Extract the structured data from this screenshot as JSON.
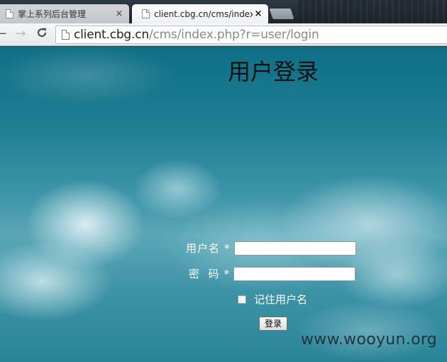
{
  "browser": {
    "tabs": [
      {
        "title": "掌上系列后台管理",
        "active": false
      },
      {
        "title": "client.cbg.cn/cms/index.",
        "active": true
      }
    ],
    "url_host": "client.cbg.cn",
    "url_path": "/cms/index.php?r=user/login",
    "nav": {
      "back": "←",
      "forward": "→",
      "reload": "C"
    },
    "close_glyph": "×"
  },
  "page": {
    "title": "用户登录",
    "form": {
      "username_label": "用户名",
      "password_label": "密  码",
      "required_mark": "*",
      "username_value": "",
      "password_value": "",
      "remember_label": "记住用户名",
      "remember_checked": false,
      "submit_label": "登录"
    },
    "watermark": "www.wooyun.org"
  }
}
